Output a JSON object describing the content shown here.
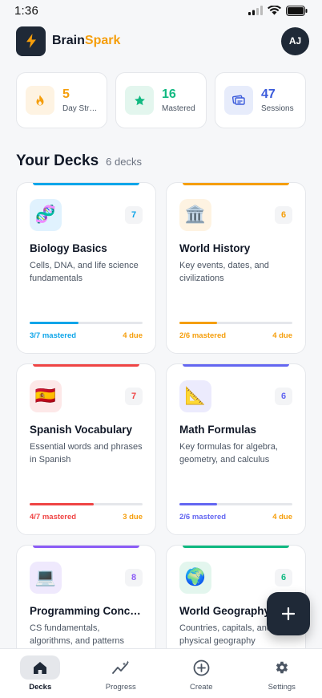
{
  "status": {
    "time": "1:36"
  },
  "app": {
    "name_part1": "Brain",
    "name_part2": "Spark",
    "user_initials": "AJ"
  },
  "stats": [
    {
      "value": "5",
      "label": "Day Streak",
      "icon": "flame-icon",
      "color": "#f59e0b",
      "bg": "#fef3e2"
    },
    {
      "value": "16",
      "label": "Mastered",
      "icon": "star-icon",
      "color": "#10b981",
      "bg": "#e3f6ee"
    },
    {
      "value": "47",
      "label": "Sessions",
      "icon": "cards-icon",
      "color": "#3b5bdb",
      "bg": "#e7ecfb"
    }
  ],
  "section": {
    "title": "Your Decks",
    "count": "6 decks"
  },
  "decks": [
    {
      "icon": "🧬",
      "icon_name": "dna-icon",
      "icon_bg": "#e0f2fe",
      "color": "#0ea5e9",
      "count": "7",
      "title": "Biology Basics",
      "description": "Cells, DNA, and life science fundamentals",
      "mastered": "3/7 mastered",
      "due": "4 due",
      "progress": 0.43
    },
    {
      "icon": "🏛️",
      "icon_name": "museum-icon",
      "icon_bg": "#fef3e2",
      "color": "#f59e0b",
      "count": "6",
      "title": "World History",
      "description": "Key events, dates, and civilizations",
      "mastered": "2/6 mastered",
      "due": "4 due",
      "progress": 0.33
    },
    {
      "icon": "🇪🇸",
      "icon_name": "spain-flag-icon",
      "icon_bg": "#fde8e8",
      "color": "#ef4444",
      "count": "7",
      "title": "Spanish Vocabulary",
      "description": "Essential words and phrases in Spanish",
      "mastered": "4/7 mastered",
      "due": "3 due",
      "progress": 0.57
    },
    {
      "icon": "📐",
      "icon_name": "ruler-icon",
      "icon_bg": "#ecebfd",
      "color": "#6366f1",
      "count": "6",
      "title": "Math Formulas",
      "description": "Key formulas for algebra, geometry, and calculus",
      "mastered": "2/6 mastered",
      "due": "4 due",
      "progress": 0.33
    },
    {
      "icon": "💻",
      "icon_name": "laptop-icon",
      "icon_bg": "#efe9fd",
      "color": "#8b5cf6",
      "count": "8",
      "title": "Programming Concepts",
      "description": "CS fundamentals, algorithms, and patterns",
      "mastered": "",
      "due": "",
      "progress": 0
    },
    {
      "icon": "🌍",
      "icon_name": "globe-icon",
      "icon_bg": "#e3f6ee",
      "color": "#10b981",
      "count": "6",
      "title": "World Geography",
      "description": "Countries, capitals, and physical geography",
      "mastered": "",
      "due": "",
      "progress": 0
    }
  ],
  "nav": [
    {
      "label": "Decks",
      "icon": "home-icon",
      "active": true
    },
    {
      "label": "Progress",
      "icon": "sparkline-icon",
      "active": false
    },
    {
      "label": "Create",
      "icon": "plus-circle-icon",
      "active": false
    },
    {
      "label": "Settings",
      "icon": "gear-icon",
      "active": false
    }
  ]
}
